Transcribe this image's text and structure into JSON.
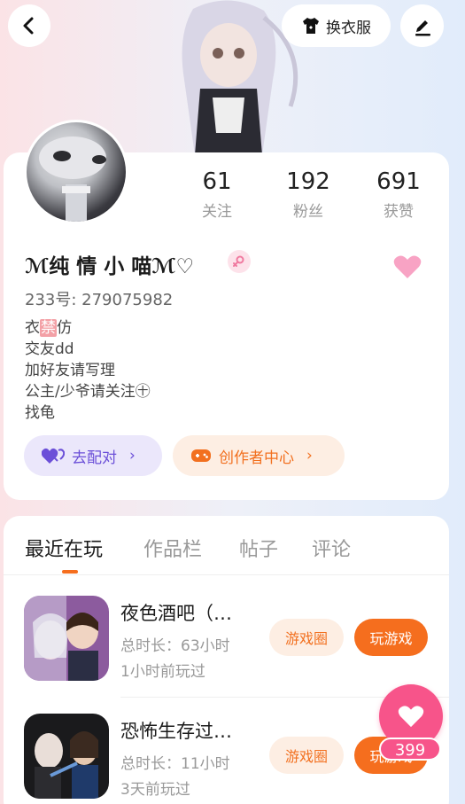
{
  "header": {
    "outfit_label": "换衣服"
  },
  "profile": {
    "nickname": "ℳ纯 情 小 喵ℳ♡",
    "uid_label": "233号:",
    "uid": "279075982",
    "stats": [
      {
        "value": "61",
        "label": "关注"
      },
      {
        "value": "192",
        "label": "粉丝"
      },
      {
        "value": "691",
        "label": "获赞"
      }
    ],
    "bio": {
      "line1_pre": "衣",
      "line1_banned": "禁",
      "line1_post": "仿",
      "line2": "交友dd",
      "line3": "加好友请写理",
      "line4": "公主/少爷请关注㊉",
      "line5": "找龟"
    },
    "pair_label": "去配对",
    "creator_label": "创作者中心"
  },
  "tabs": [
    "最近在玩",
    "作品栏",
    "帖子",
    "评论"
  ],
  "games": [
    {
      "title": "夜色酒吧（…",
      "duration": "总时长：63小时",
      "last_played": "1小时前玩过",
      "circle_label": "游戏圈",
      "play_label": "玩游戏"
    },
    {
      "title": "恐怖生存过…",
      "duration": "总时长：11小时",
      "last_played": "3天前玩过",
      "circle_label": "游戏圈",
      "play_label": "玩游戏"
    }
  ],
  "fab": {
    "count": "399"
  },
  "colors": {
    "accent": "#f56e1e",
    "pink": "#f7548a",
    "purple": "#6b4fd8"
  }
}
